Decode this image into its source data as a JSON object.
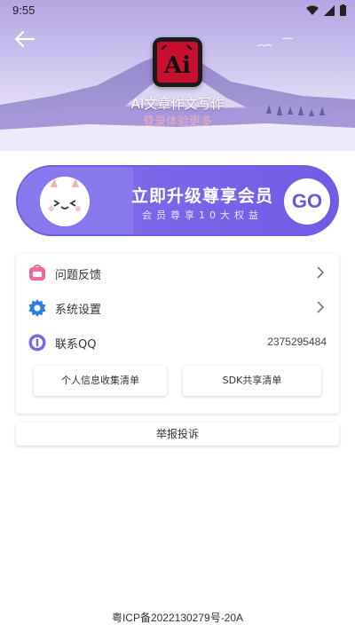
{
  "status_bar": {
    "time": "9:55"
  },
  "header": {
    "app_title": "AI文章作文写作",
    "login_hint": "登录体验更多",
    "logo_text": "Ai"
  },
  "vip_banner": {
    "title": "立即升级尊享会员",
    "subtitle": "会员尊享10大权益",
    "go_label": "GO"
  },
  "menu": {
    "items": [
      {
        "label": "问题反馈",
        "icon": "feedback-icon"
      },
      {
        "label": "系统设置",
        "icon": "gear-icon"
      },
      {
        "label": "联系QQ",
        "icon": "qq-icon",
        "value": "2375295484"
      }
    ],
    "buttons": [
      {
        "label": "个人信息收集清单"
      },
      {
        "label": "SDK共享清单"
      }
    ]
  },
  "report_label": "举报投诉",
  "footer": {
    "icp": "粤ICP备2022130279号-20A"
  },
  "colors": {
    "accent": "#7a67e8",
    "feedback_icon": "#f06aa0",
    "gear_icon": "#2a7fe0",
    "qq_icon": "#7a67e8",
    "login_hint": "#f3a9c4"
  }
}
